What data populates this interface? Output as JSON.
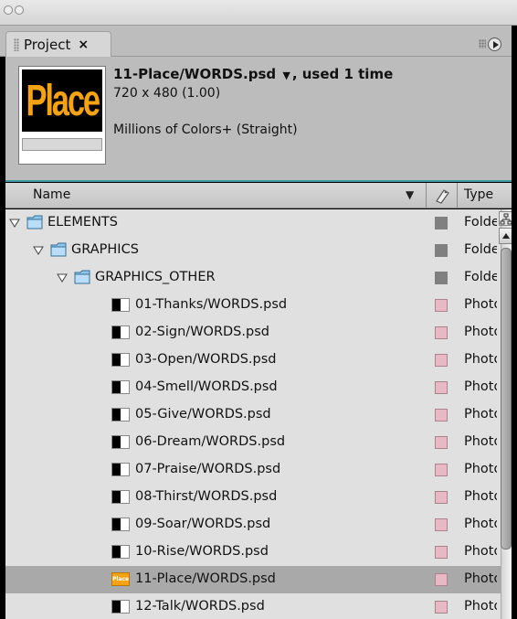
{
  "panel": {
    "tab_label": "Project",
    "close_symbol": "×"
  },
  "info": {
    "thumb_text": "Place",
    "title": "11-Place/WORDS.psd",
    "used": ", used 1 time",
    "dimensions": "720 x 480 (1.00)",
    "colors": "Millions of Colors+ (Straight)"
  },
  "columns": {
    "name": "Name",
    "type": "Type"
  },
  "items": [
    {
      "label": "ELEMENTS",
      "type": "Folder",
      "kind": "folder",
      "level": 0
    },
    {
      "label": "GRAPHICS",
      "type": "Folder",
      "kind": "folder",
      "level": 1
    },
    {
      "label": "GRAPHICS_OTHER",
      "type": "Folder",
      "kind": "folder",
      "level": 2
    },
    {
      "label": "01-Thanks/WORDS.psd",
      "type": "Photoshop",
      "kind": "file",
      "level": 3
    },
    {
      "label": "02-Sign/WORDS.psd",
      "type": "Photoshop",
      "kind": "file",
      "level": 3
    },
    {
      "label": "03-Open/WORDS.psd",
      "type": "Photoshop",
      "kind": "file",
      "level": 3
    },
    {
      "label": "04-Smell/WORDS.psd",
      "type": "Photoshop",
      "kind": "file",
      "level": 3
    },
    {
      "label": "05-Give/WORDS.psd",
      "type": "Photoshop",
      "kind": "file",
      "level": 3
    },
    {
      "label": "06-Dream/WORDS.psd",
      "type": "Photoshop",
      "kind": "file",
      "level": 3
    },
    {
      "label": "07-Praise/WORDS.psd",
      "type": "Photoshop",
      "kind": "file",
      "level": 3
    },
    {
      "label": "08-Thirst/WORDS.psd",
      "type": "Photoshop",
      "kind": "file",
      "level": 3
    },
    {
      "label": "09-Soar/WORDS.psd",
      "type": "Photoshop",
      "kind": "file",
      "level": 3
    },
    {
      "label": "10-Rise/WORDS.psd",
      "type": "Photoshop",
      "kind": "file",
      "level": 3
    },
    {
      "label": "11-Place/WORDS.psd",
      "type": "Photoshop",
      "kind": "file-place",
      "level": 3,
      "selected": true
    },
    {
      "label": "12-Talk/WORDS.psd",
      "type": "Photoshop",
      "kind": "file",
      "level": 3
    }
  ],
  "colors": {
    "folder_label": "#808080",
    "file_label": "#e8b8c6",
    "selection": "#a9a9a9",
    "accent_line": "#3f9aa8"
  }
}
